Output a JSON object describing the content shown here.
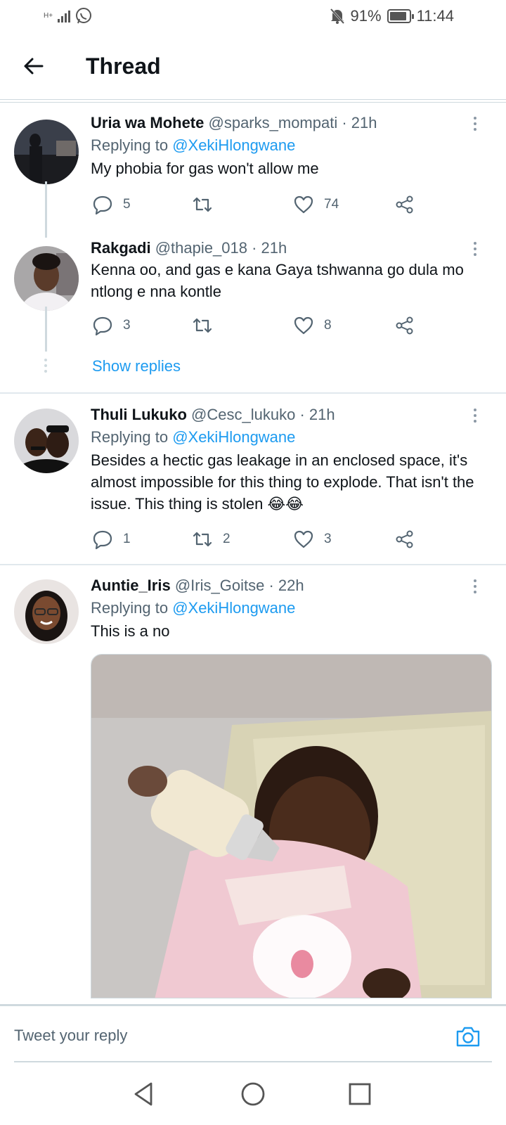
{
  "status_bar": {
    "network": "H+",
    "battery_percent": "91%",
    "battery_level": 0.91,
    "time": "11:44"
  },
  "header": {
    "title": "Thread"
  },
  "tweets": [
    {
      "name": "Uria wa Mohete",
      "handle": "@sparks_mompati",
      "time": "· 21h",
      "replying_prefix": "Replying to ",
      "replying_to": "@XekiHlongwane",
      "text": "My phobia for gas won't allow me",
      "replies": "5",
      "retweets": "",
      "likes": "74"
    },
    {
      "name": "Rakgadi",
      "handle": "@thapie_018",
      "time": "· 21h",
      "text": "Kenna oo, and gas e kana Gaya tshwanna go dula mo ntlong e nna kontle",
      "replies": "3",
      "retweets": "",
      "likes": "8"
    },
    {
      "name": "Thuli Lukuko",
      "handle": "@Cesc_lukuko",
      "time": "· 21h",
      "replying_prefix": "Replying to ",
      "replying_to": "@XekiHlongwane",
      "text": "Besides a hectic gas leakage in an enclosed space, it's almost impossible for this thing to explode. That isn't the issue. This thing is stolen 😂😂",
      "replies": "1",
      "retweets": "2",
      "likes": "3"
    },
    {
      "name": "Auntie_Iris",
      "handle": "@Iris_Goitse",
      "time": "· 22h",
      "replying_prefix": "Replying to ",
      "replying_to": "@XekiHlongwane",
      "text": "This is a no"
    }
  ],
  "show_replies": "Show replies",
  "reply_bar": {
    "placeholder": "Tweet your reply"
  },
  "colors": {
    "link": "#1d9bf0",
    "secondary_text": "#536471",
    "divider": "#e1e8ed"
  },
  "icons": [
    "back-arrow-icon",
    "reply-icon",
    "retweet-icon",
    "like-icon",
    "share-icon",
    "more-icon",
    "camera-icon",
    "nav-back-icon",
    "nav-home-icon",
    "nav-recents-icon"
  ]
}
